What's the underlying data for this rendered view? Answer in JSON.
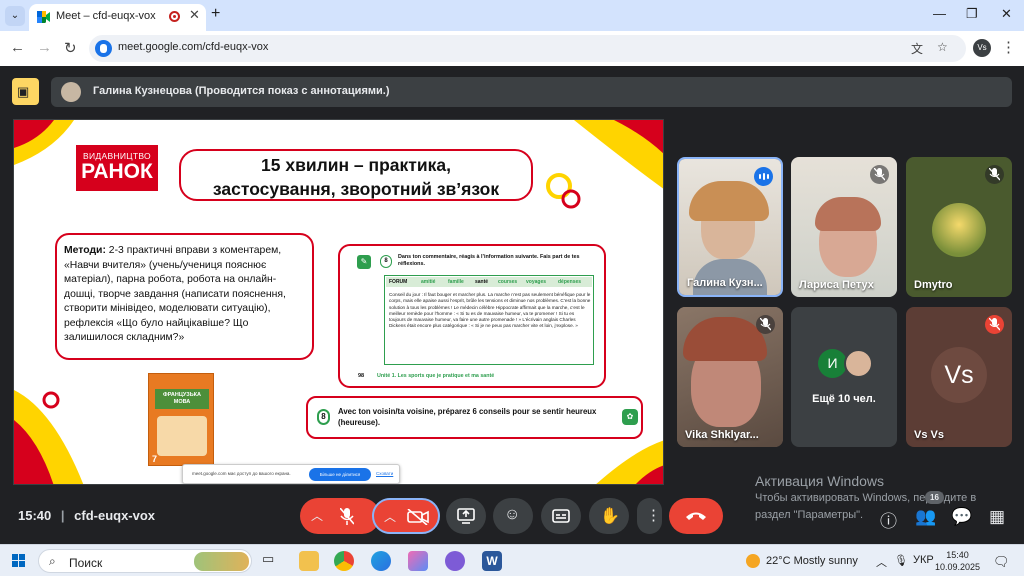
{
  "browser": {
    "tab_title": "Meet – cfd-euqx-vox",
    "url": "meet.google.com/cfd-euqx-vox",
    "profile_initials": "Vs"
  },
  "meet": {
    "presenter_banner": "Галина Кузнецова (Проводится показ с аннотациями.)",
    "meeting_time": "15:40",
    "meeting_code": "cfd-euqx-vox",
    "participants_count": "16"
  },
  "slide": {
    "publisher_small": "ВИДАВНИЦТВО",
    "publisher_big": "РАНОК",
    "title_line1": "15 хвилин – практика,",
    "title_line2": "застосування, зворотний зв’язок",
    "methods_label": "Методи:",
    "methods_text": " 2-3 практичні вправи з коментарем, «Навчи вчителя» (учень/учениця пояснює матеріал), парна робота, робота на онлайн-дошці, творче завдання (написати пояснення, створити мінівідео, моделювати ситуацію), рефлексія «Що було найцікавіше? Що залишилося складним?»",
    "exercise_num": "8",
    "exercise_instruction": "Dans ton commentaire, réagis à l’information suivante. Fais part de tes réflexions.",
    "forum_tabs": [
      "FORUM",
      "amitié",
      "famille",
      "santé",
      "courses",
      "voyages",
      "dépenses"
    ],
    "forum_text": "Conseil du jour : Il faut bouger et marcher plus. La marche n’est pas seulement bénéfique pour le corps, mais elle apaise aussi l’esprit, brûle les tensions et diminue nos problèmes. C’est la bonne solution à tous les problèmes ! Le médecin célèbre Hippocrate affirmait que la marche, c’est le meilleur remède pour l’homme : « Si tu es de mauvaise humeur, va te promener ! Si tu es toujours de mauvaise humeur, va faire une autre promenade ! » L’écrivain anglais Charles Dickens était encore plus catégorique : « Si je ne peux pas marcher vite et loin, j’explose. »",
    "page_num": "98",
    "unit_text": "Unité 1. Les sports que je pratique et ma santé",
    "task_num": "8",
    "task_text": "Avec ton voisin/ta voisine, préparez 6 conseils pour se sentir heureux (heureuse).",
    "book_title": "ФРАНЦУЗЬКА МОВА",
    "book_grade": "7",
    "share_text": "meet.google.com має доступ до вашого екрана.",
    "share_button": "Більше не ділитися",
    "share_hide": "Сховати"
  },
  "tiles": [
    {
      "name": "Галина Кузн...",
      "state": "speaking"
    },
    {
      "name": "Лариса Петух",
      "state": "muted"
    },
    {
      "name": "Dmytro",
      "state": "muted"
    },
    {
      "name": "Vika Shklyar...",
      "state": "muted"
    },
    {
      "name": "Ещё 10 чел.",
      "initial": "И"
    },
    {
      "name": "Vs Vs",
      "initials": "Vs",
      "state": "muted"
    }
  ],
  "activation": {
    "title": "Активация Windows",
    "line1": "Чтобы активировать Windows, перейдите в",
    "line2": "раздел \"Параметры\"."
  },
  "taskbar": {
    "search_label": "Поиск",
    "weather": "22°C  Mostly sunny",
    "lang": "УКР",
    "time": "15:40",
    "date": "10.09.2025"
  },
  "colors": {
    "meet_bg": "#202124",
    "control_bg": "#3c4043",
    "end_call": "#ea4335",
    "slide_red": "#d6001c",
    "slide_yellow": "#ffd400",
    "slide_green": "#2e9e4e",
    "highlight_blue": "#8ab4f8"
  }
}
